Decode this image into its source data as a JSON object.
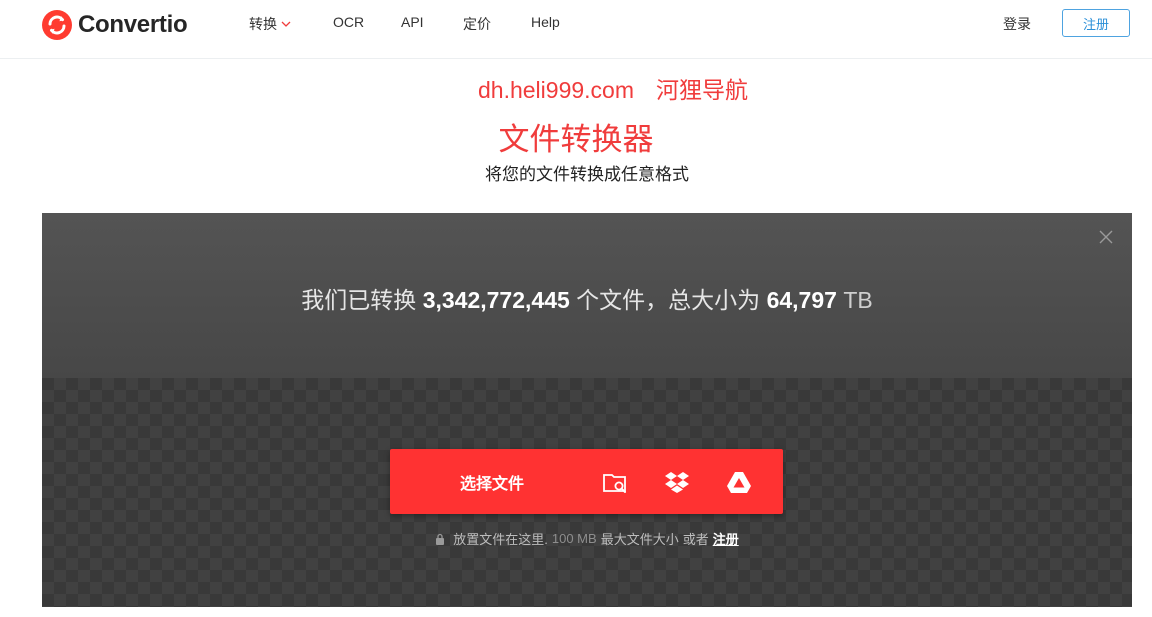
{
  "brand": {
    "name": "Convertio",
    "accent": "#f03c3c"
  },
  "nav": {
    "items": [
      {
        "label": "转换",
        "has_dropdown": true
      },
      {
        "label": "OCR"
      },
      {
        "label": "API"
      },
      {
        "label": "定价"
      },
      {
        "label": "Help"
      }
    ],
    "login": "登录",
    "register": "注册"
  },
  "watermark": {
    "domain": "dh.heli999.com",
    "name": "河狸导航"
  },
  "hero": {
    "title": "文件转换器",
    "subtitle": "将您的文件转换成任意格式"
  },
  "stats": {
    "prefix": "我们已转换",
    "files_count": "3,342,772,445",
    "middle": "个文件，总大小为",
    "total_size": "64,797",
    "unit": "TB"
  },
  "upload": {
    "choose_label": "选择文件",
    "sources": [
      "folder-search-icon",
      "dropbox-icon",
      "google-drive-icon"
    ],
    "hint_prefix": "放置文件在这里.",
    "max_size": "100 MB",
    "hint_middle": "最大文件大小",
    "or": "或者",
    "register_link": "注册"
  }
}
